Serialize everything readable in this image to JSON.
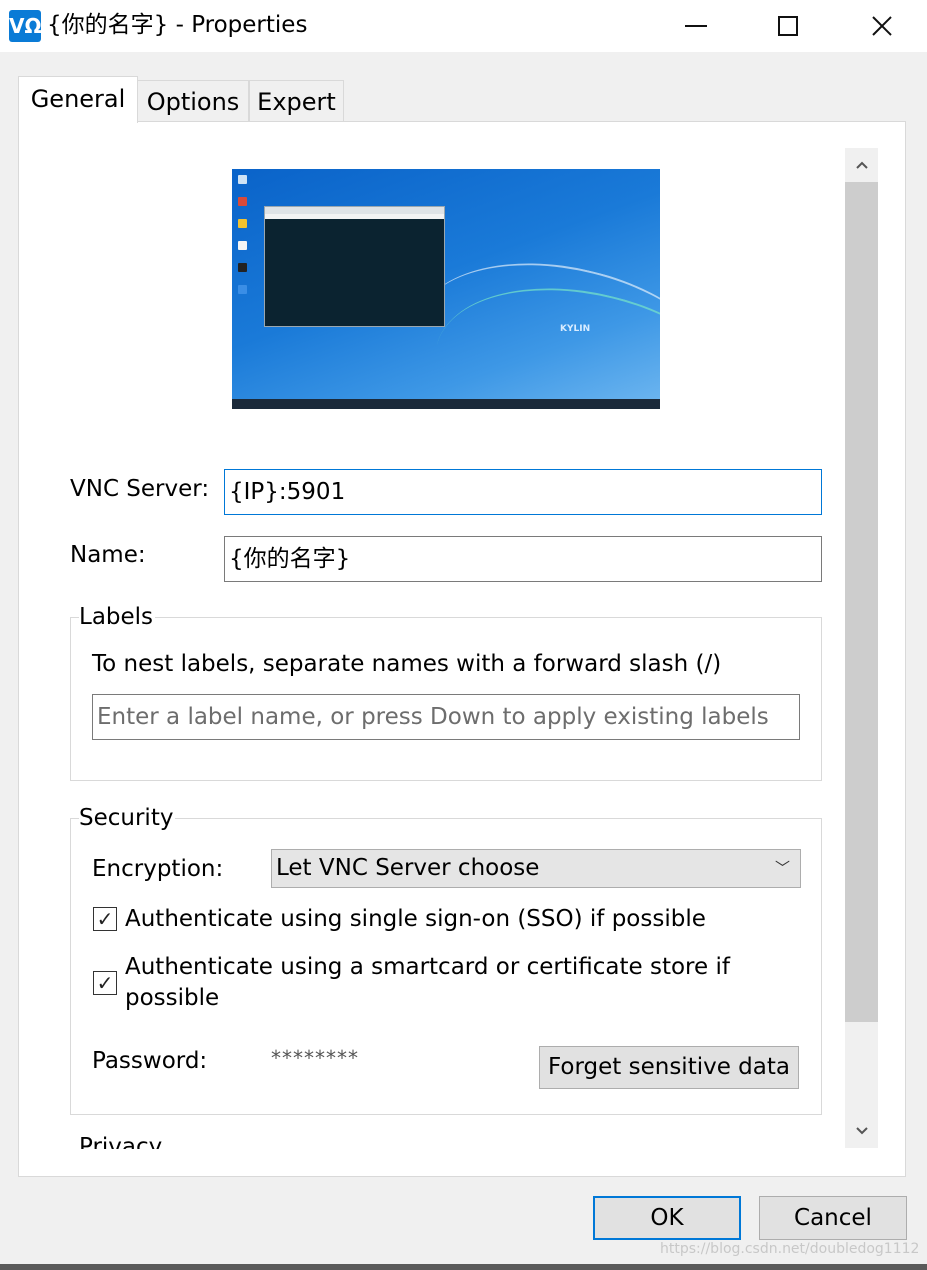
{
  "window": {
    "app_icon_text": "VΩ",
    "title": "{你的名字} - Properties"
  },
  "tabs": [
    {
      "label": "General",
      "active": true
    },
    {
      "label": "Options",
      "active": false
    },
    {
      "label": "Expert",
      "active": false
    }
  ],
  "general": {
    "vnc_server_label": "VNC Server:",
    "vnc_server_value": "{IP}:5901",
    "name_label": "Name:",
    "name_value": "{你的名字}",
    "preview_logo": "KYLIN"
  },
  "labels_group": {
    "title": "Labels",
    "hint": "To nest labels, separate names with a forward slash (/)",
    "input_placeholder": "Enter a label name, or press Down to apply existing labels"
  },
  "security_group": {
    "title": "Security",
    "encryption_label": "Encryption:",
    "encryption_value": "Let VNC Server choose",
    "sso_label": "Authenticate using single sign-on (SSO) if possible",
    "sso_checked": true,
    "smartcard_label": "Authenticate using a smartcard or certificate store if possible",
    "smartcard_checked": true,
    "password_label": "Password:",
    "password_value": "********",
    "forget_button": "Forget sensitive data"
  },
  "privacy_group": {
    "title": "Privacy"
  },
  "footer": {
    "ok": "OK",
    "cancel": "Cancel"
  },
  "watermark": "https://blog.csdn.net/doubledog1112",
  "colors": {
    "accent": "#0078d7",
    "dialog_bg": "#f0f0f0",
    "panel_bg": "#ffffff"
  },
  "icons": {
    "minimize": "minimize-icon",
    "maximize": "maximize-icon",
    "close": "close-icon",
    "dropdown": "chevron-down-icon",
    "check": "checkmark-icon"
  }
}
